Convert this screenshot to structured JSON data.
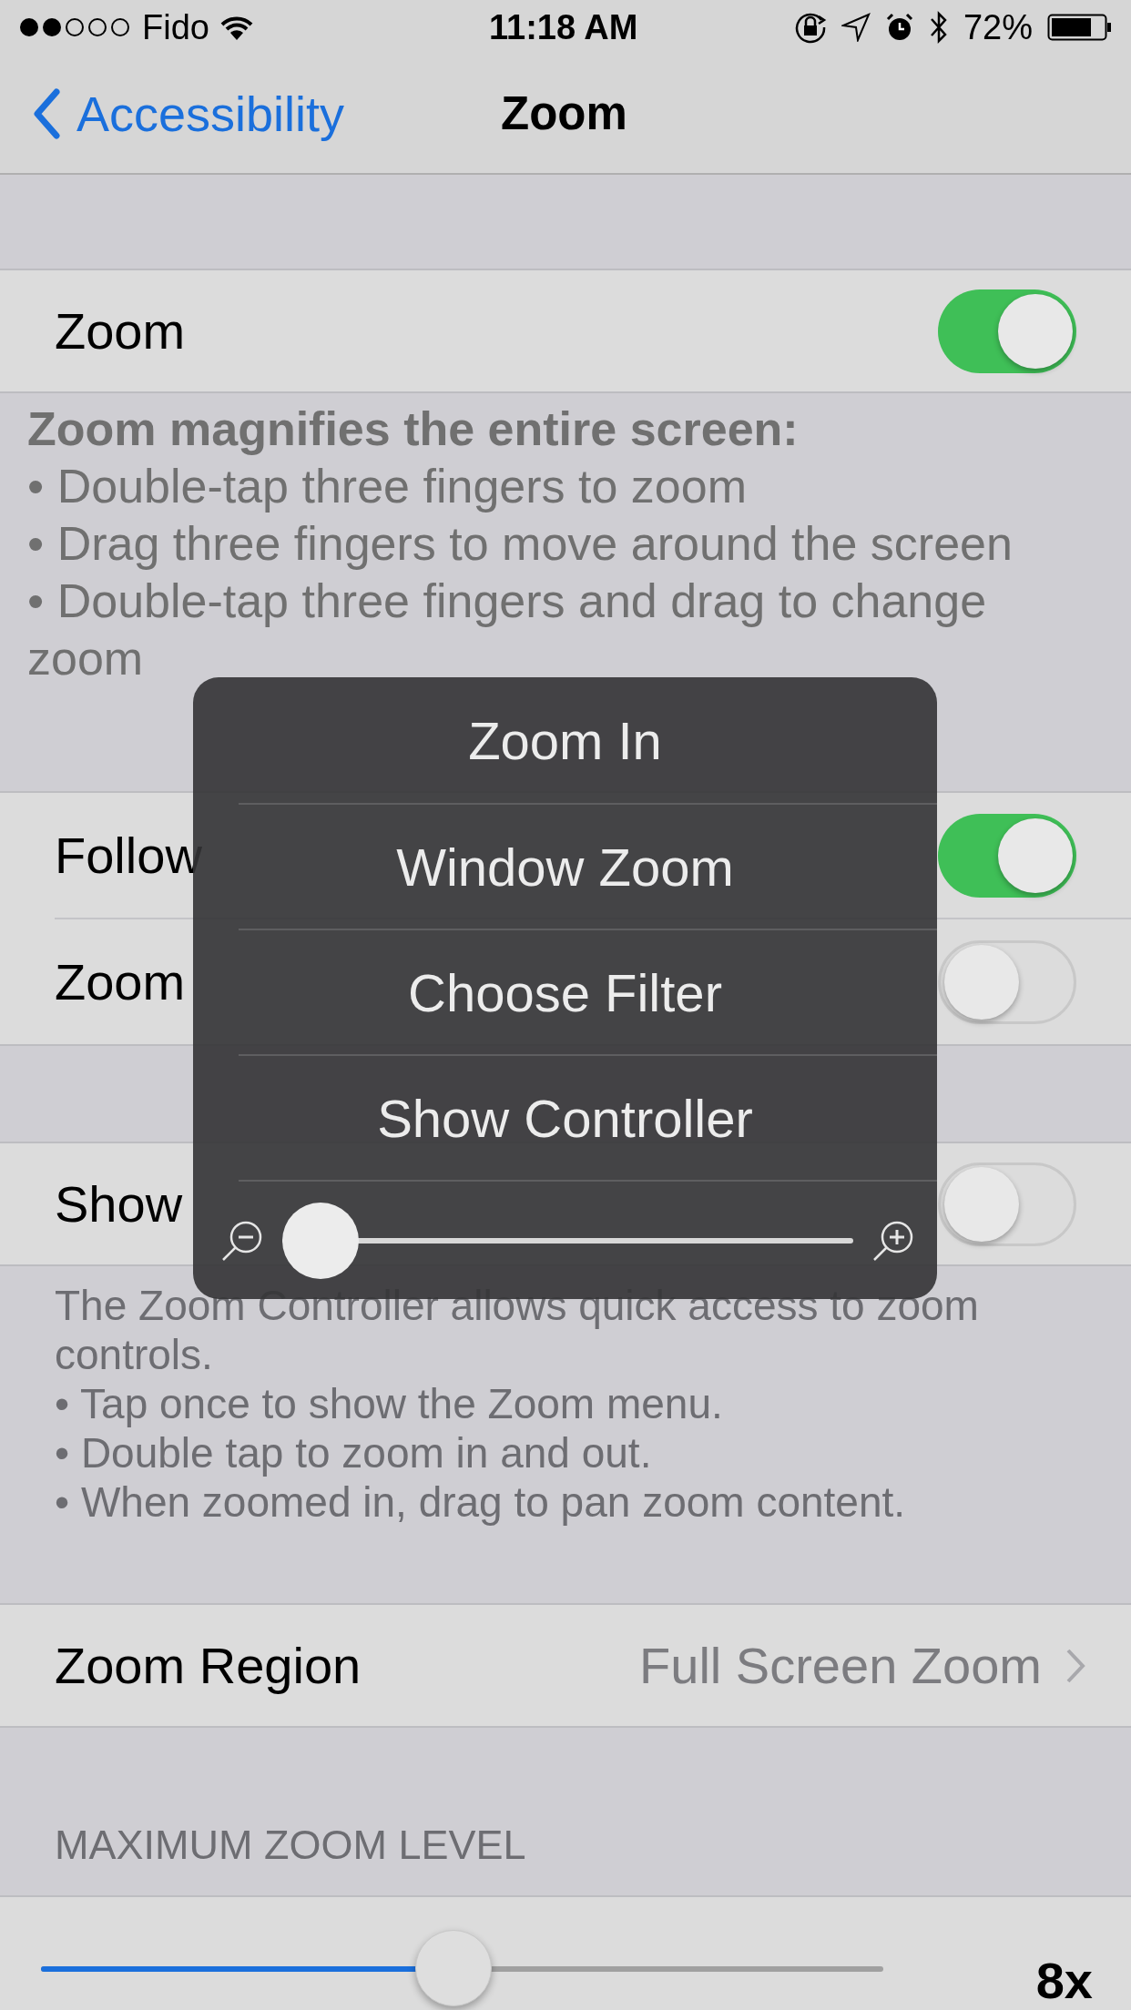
{
  "status_bar": {
    "carrier": "Fido",
    "time": "11:18 AM",
    "battery": "72%"
  },
  "nav": {
    "back": "Accessibility",
    "title": "Zoom"
  },
  "zoom_row": {
    "label": "Zoom",
    "on": true
  },
  "zoom_footer": "**Zoom magnifies the entire screen:**\n•  Double-tap three fingers to zoom\n•  Drag three fingers to move around the screen\n•  Double-tap three fingers and drag to change zoom",
  "focus_rows": [
    {
      "label": "Follow",
      "on": true
    },
    {
      "label": "Zoom",
      "on": false
    }
  ],
  "controller_row": {
    "label": "Show",
    "on": false
  },
  "controller_footer": "The Zoom Controller allows quick access to zoom controls.\n• Tap once to show the Zoom menu.\n• Double tap to zoom in and out.\n• When zoomed in, drag to pan zoom content.",
  "region_row": {
    "label": "Zoom Region",
    "value": "Full Screen Zoom"
  },
  "max_zoom": {
    "header": "MAXIMUM ZOOM LEVEL",
    "level": 0.49,
    "reading": "8x"
  },
  "zoom_menu": {
    "items": [
      "Zoom In",
      "Window Zoom",
      "Choose Filter",
      "Show Controller"
    ],
    "level": 0
  }
}
